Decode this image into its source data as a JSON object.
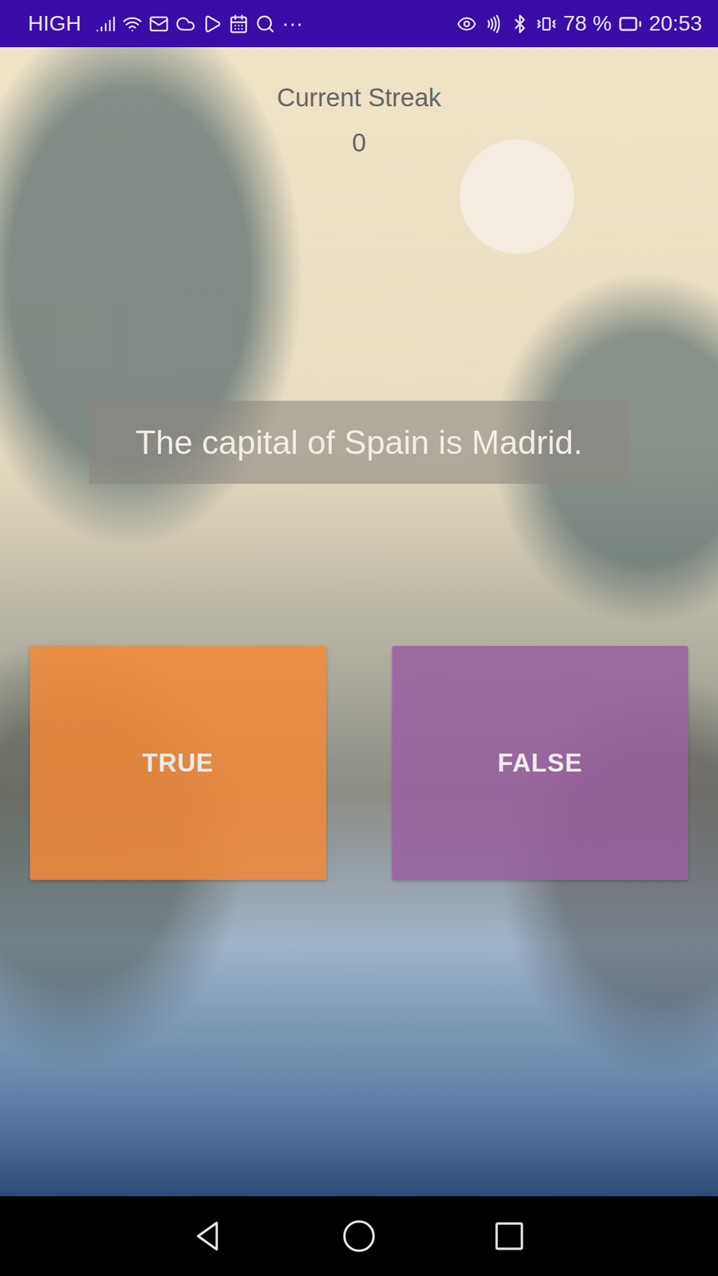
{
  "status_bar": {
    "signal": "HIGH",
    "more": "···",
    "battery": "78 %",
    "time": "20:53"
  },
  "streak": {
    "label": "Current Streak",
    "value": "0"
  },
  "question": "The capital of Spain is Madrid.",
  "answers": [
    {
      "label": "TRUE",
      "color": "#f28a3a"
    },
    {
      "label": "FALSE",
      "color": "#9b5fa3"
    }
  ]
}
